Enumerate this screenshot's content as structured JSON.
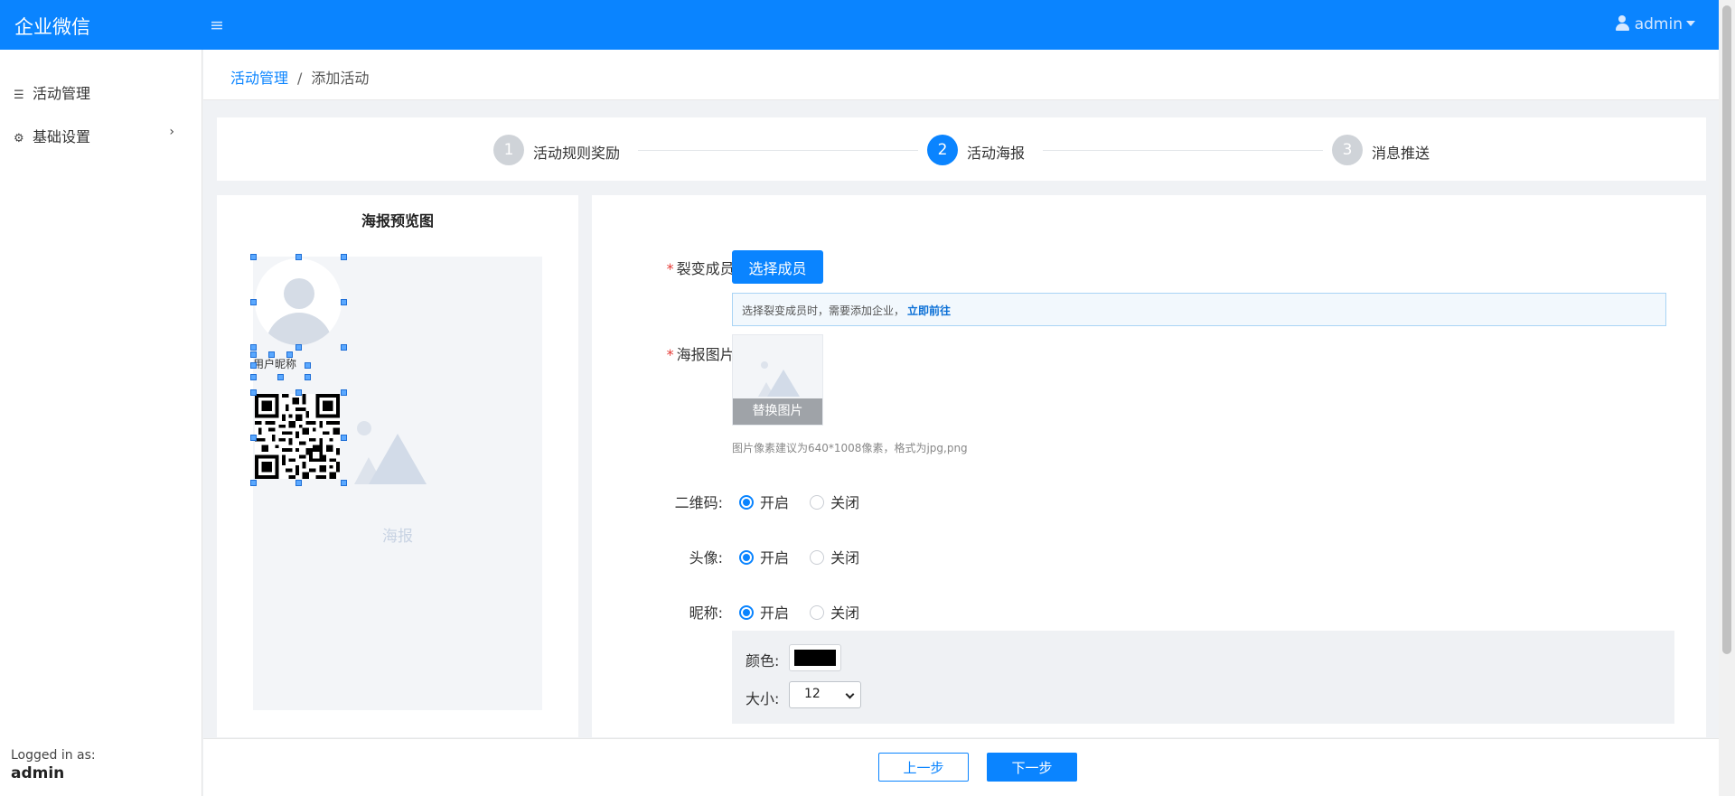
{
  "app": {
    "brand": "企业微信",
    "user": "admin"
  },
  "sidebar": {
    "items": [
      {
        "label": "活动管理",
        "icon": "list-icon"
      },
      {
        "label": "基础设置",
        "icon": "gears-icon"
      }
    ],
    "logged_in_label": "Logged in as:",
    "logged_in_user": "admin"
  },
  "breadcrumb": {
    "parent": "活动管理",
    "separator": "/",
    "current": "添加活动"
  },
  "steps": [
    {
      "number": "1",
      "label": "活动规则奖励",
      "active": false
    },
    {
      "number": "2",
      "label": "活动海报",
      "active": true
    },
    {
      "number": "3",
      "label": "消息推送",
      "active": false
    }
  ],
  "preview": {
    "title": "海报预览图",
    "nickname_placeholder": "用户昵称",
    "poster_caption": "海报"
  },
  "form": {
    "member_label": "裂变成员:",
    "member_button": "选择成员",
    "member_info": "选择裂变成员时，需要添加企业，",
    "member_info_link": "立即前往",
    "poster_label": "海报图片:",
    "poster_replace": "替换图片",
    "poster_hint": "图片像素建议为640*1008像素，格式为jpg,png",
    "qrcode_label": "二维码:",
    "avatar_label": "头像:",
    "nickname_label": "昵称:",
    "on_label": "开启",
    "off_label": "关闭",
    "color_label": "颜色:",
    "color_value": "#000000",
    "size_label": "大小:",
    "size_value": "12"
  },
  "footer": {
    "prev": "上一步",
    "next": "下一步"
  },
  "colors": {
    "primary": "#0a84ff",
    "required": "#e53935"
  }
}
